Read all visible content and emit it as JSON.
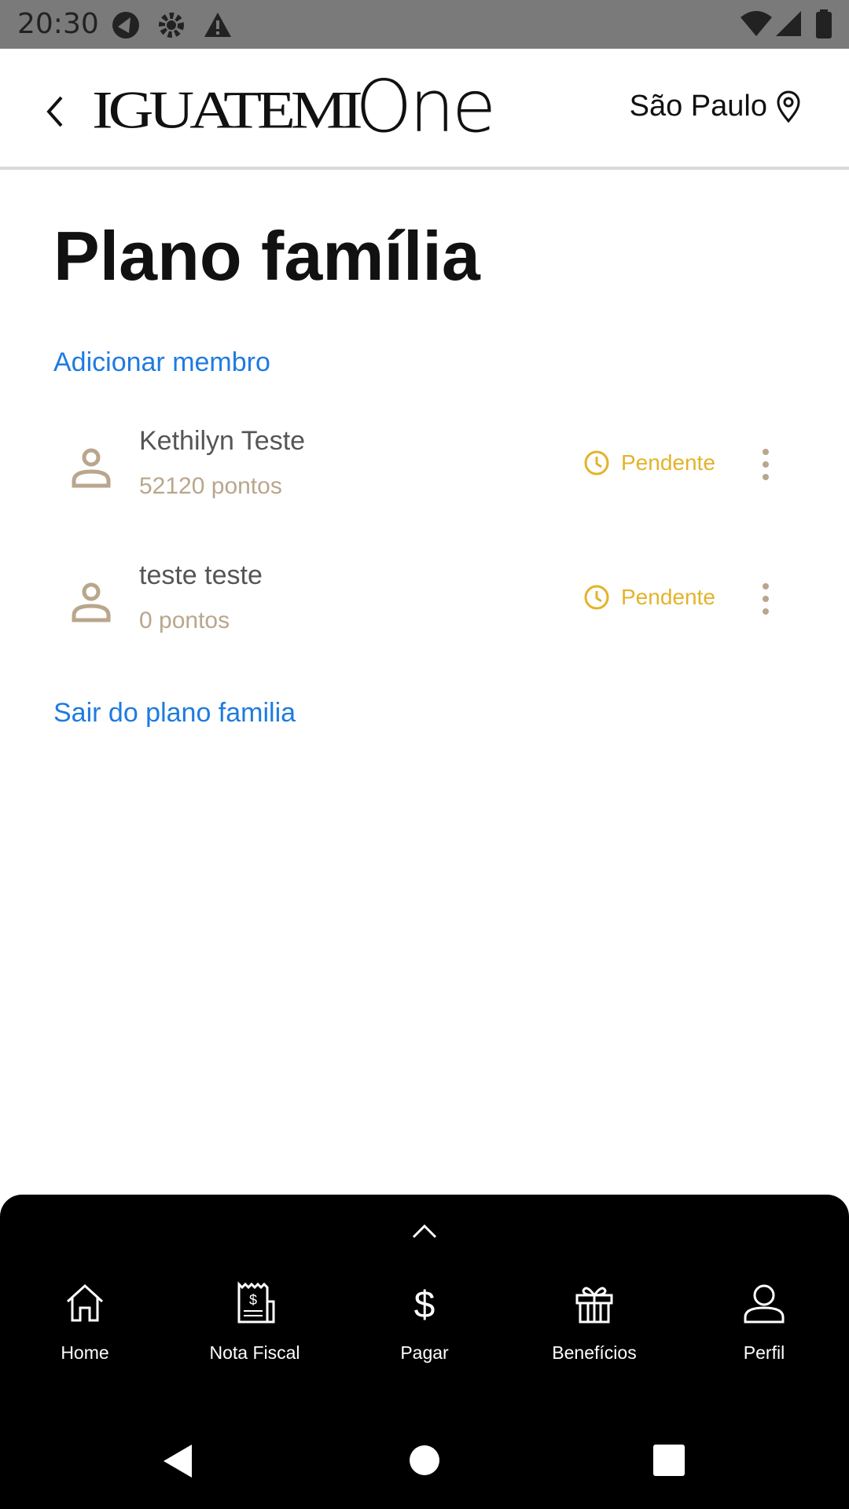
{
  "status_bar": {
    "time": "20:30"
  },
  "header": {
    "logo_main": "IGUATEMI",
    "logo_sub": "One",
    "location": "São Paulo"
  },
  "page": {
    "title": "Plano família",
    "add_member": "Adicionar membro",
    "leave_plan": "Sair do plano familia"
  },
  "members": [
    {
      "name": "Kethilyn Teste",
      "points": "52120 pontos",
      "status": "Pendente"
    },
    {
      "name": "teste teste",
      "points": "0 pontos",
      "status": "Pendente"
    }
  ],
  "bottom_nav": {
    "items": [
      {
        "label": "Home",
        "icon": "home-icon"
      },
      {
        "label": "Nota Fiscal",
        "icon": "receipt-icon"
      },
      {
        "label": "Pagar",
        "icon": "dollar-icon"
      },
      {
        "label": "Benefícios",
        "icon": "gift-icon"
      },
      {
        "label": "Perfil",
        "icon": "user-icon"
      }
    ]
  },
  "colors": {
    "link": "#1e7be0",
    "status_pending": "#e4b32b",
    "points": "#b9a68c",
    "avatar": "#b9a68c"
  }
}
